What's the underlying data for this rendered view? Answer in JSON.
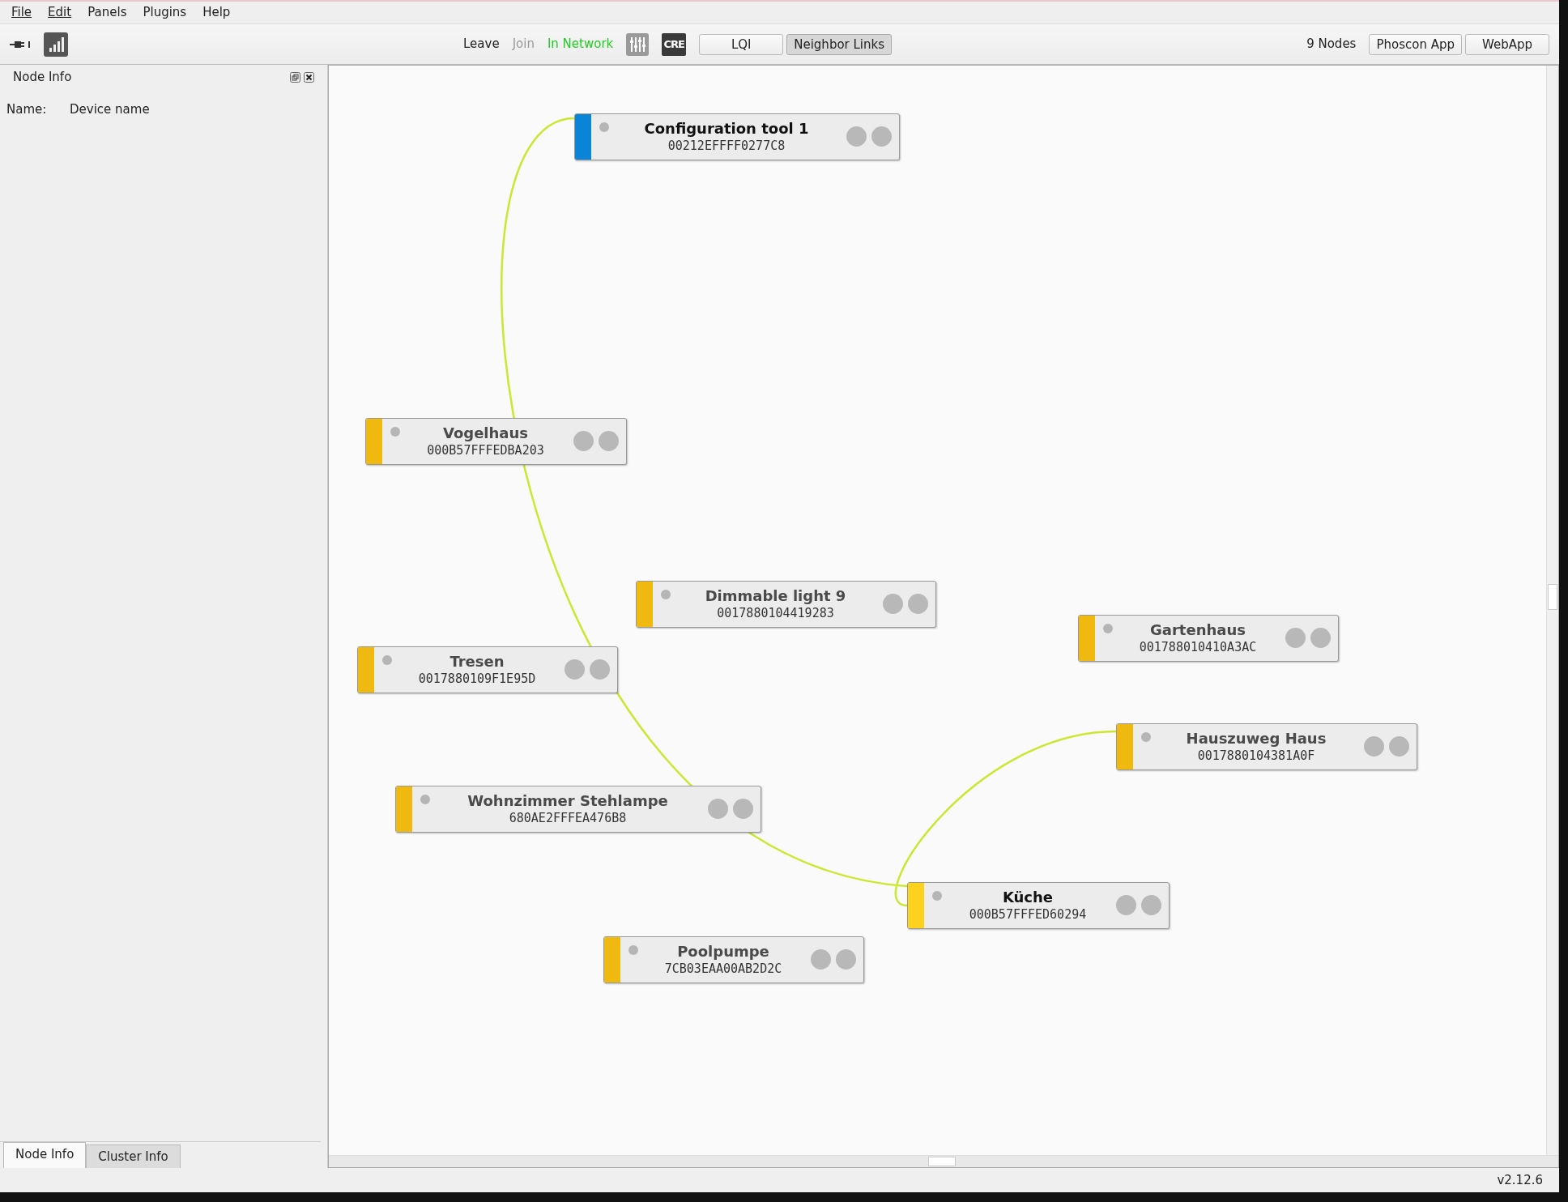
{
  "menu": [
    {
      "label": "File",
      "underline_first": true
    },
    {
      "label": "Edit",
      "underline_first": true
    },
    {
      "label": "Panels",
      "underline_first": false
    },
    {
      "label": "Plugins",
      "underline_first": false
    },
    {
      "label": "Help",
      "underline_first": false
    }
  ],
  "toolbar": {
    "network_actions": [
      {
        "label": "Leave",
        "kind": "action",
        "disabled": false
      },
      {
        "label": "Join",
        "kind": "action",
        "disabled": true
      },
      {
        "label": "In Network",
        "kind": "status"
      }
    ],
    "badge": "CRE",
    "view_buttons": [
      {
        "label": "LQI",
        "pressed": false
      },
      {
        "label": "Neighbor Links",
        "pressed": true
      }
    ],
    "node_count": "9 Nodes",
    "app_buttons": [
      "Phoscon App",
      "WebApp"
    ]
  },
  "side_panel": {
    "title": "Node Info",
    "fields": [
      {
        "label": "Name:",
        "value": "Device name"
      }
    ],
    "tabs": [
      {
        "label": "Node Info",
        "selected": true
      },
      {
        "label": "Cluster Info",
        "selected": false
      }
    ]
  },
  "nodes": [
    {
      "name": "Configuration tool 1",
      "address": "00212EFFFF0277C8",
      "color": "#0a84d6",
      "highlighted": true
    },
    {
      "name": "Vogelhaus",
      "address": "000B57FFFEDBA203",
      "color": "#f0b90f",
      "highlighted": false
    },
    {
      "name": "Dimmable light 9",
      "address": "0017880104419283",
      "color": "#f0b90f",
      "highlighted": false
    },
    {
      "name": "Gartenhaus",
      "address": "001788010410A3AC",
      "color": "#f0b90f",
      "highlighted": false
    },
    {
      "name": "Tresen",
      "address": "0017880109F1E95D",
      "color": "#f0b90f",
      "highlighted": false
    },
    {
      "name": "Hauszuweg Haus",
      "address": "0017880104381A0F",
      "color": "#f0b90f",
      "highlighted": false
    },
    {
      "name": "Wohnzimmer Stehlampe",
      "address": "680AE2FFFEA476B8",
      "color": "#f0b90f",
      "highlighted": false
    },
    {
      "name": "Küche",
      "address": "000B57FFFED60294",
      "color": "#fcd21f",
      "highlighted": true
    },
    {
      "name": "Poolpumpe",
      "address": "7CB03EAA00AB2D2C",
      "color": "#f0b90f",
      "highlighted": false
    }
  ],
  "status_bar": {
    "version": "v2.12.6"
  }
}
